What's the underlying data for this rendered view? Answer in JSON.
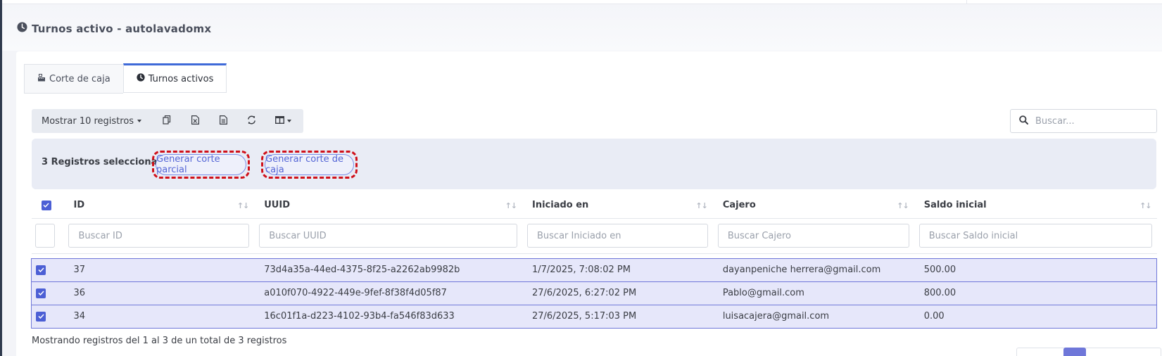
{
  "page": {
    "title": "Turnos activo - autolavadomx"
  },
  "tabs": [
    {
      "label": "Corte de caja",
      "icon": "cash-register-icon"
    },
    {
      "label": "Turnos activos",
      "icon": "clock-icon",
      "active": true
    }
  ],
  "toolbar": {
    "show_label": "Mostrar 10 registros",
    "buttons": [
      "copy-icon",
      "excel-icon",
      "csv-icon",
      "refresh-icon",
      "columns-icon"
    ]
  },
  "search": {
    "placeholder": "Buscar..."
  },
  "selection": {
    "text": "3 Registros seleccionados",
    "partial_label": "Generar corte parcial",
    "full_label": "Generar corte de caja"
  },
  "table": {
    "columns": [
      "ID",
      "UUID",
      "Iniciado en",
      "Cajero",
      "Saldo inicial"
    ],
    "filters": [
      "Buscar ID",
      "Buscar UUID",
      "Buscar Iniciado en",
      "Buscar Cajero",
      "Buscar Saldo inicial"
    ],
    "rows": [
      {
        "id": "37",
        "uuid": "73d4a35a-44ed-4375-8f25-a2262ab9982b",
        "started": "1/7/2025, 7:08:02 PM",
        "cashier": "dayanpeniche herrera@gmail.com",
        "balance": "500.00"
      },
      {
        "id": "36",
        "uuid": "a010f070-4922-449e-9fef-8f38f4d05f87",
        "started": "27/6/2025, 6:27:02 PM",
        "cashier": "Pablo@gmail.com",
        "balance": "800.00"
      },
      {
        "id": "34",
        "uuid": "16c01f1a-d223-4102-93b4-fa546f83d633",
        "started": "27/6/2025, 5:17:03 PM",
        "cashier": "luisacajera@gmail.com",
        "balance": "0.00"
      }
    ]
  },
  "footer": {
    "text": "Mostrando registros del 1 al 3 de un total de 3 registros"
  },
  "colors": {
    "accent": "#4c5fd5",
    "highlight": "#d0101a",
    "selected_row": "#e6e7fa"
  }
}
